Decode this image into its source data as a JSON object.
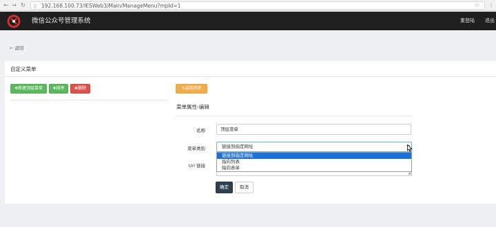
{
  "browser": {
    "address": "192.168.100.73/IESWeb3/Main/ManageMenu?mpId=1",
    "back_icon": "arrow-left-icon",
    "forward_icon": "arrow-right-icon",
    "reload_icon": "reload-icon",
    "page_icon": "page-icon",
    "bookmark_icon": "star-icon"
  },
  "header": {
    "title": "微信公众号管理系统",
    "relogin": "重登陆",
    "logout": "退出",
    "logo_icon": "brand-logo",
    "background": "#1f1f1f"
  },
  "back_link": "← 返回",
  "panel": {
    "title": "自定义菜单",
    "buttons": {
      "new_top_menu": "✚新建顶层菜单",
      "sort": "✚排序",
      "delete": "✖删除",
      "enable": "✎启用同步"
    }
  },
  "form": {
    "section_title": "菜单属性-编辑",
    "name_label": "名称",
    "name_value": "顶层菜单",
    "type_label": "菜单类别",
    "type_value": "链接到指定网址",
    "url_label": "Url 链接",
    "type_options": [
      "链接到指定网址",
      "指向列表",
      "指向表单"
    ],
    "confirm": "确定",
    "cancel": "取消"
  },
  "colors": {
    "success": "#5cb85c",
    "danger": "#d9534f",
    "warning": "#f0ad4e",
    "primary": "#2f4050",
    "selected_option": "#1e70d8"
  }
}
